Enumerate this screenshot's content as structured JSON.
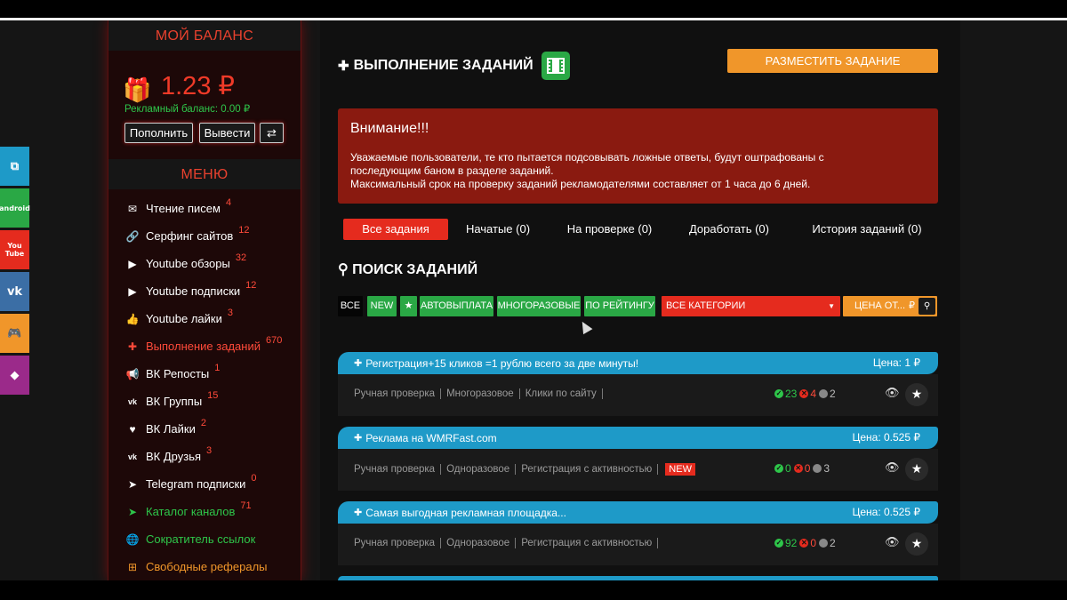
{
  "sidebar": {
    "balance_title": "МОЙ БАЛАНС",
    "balance_amount": "1.23 ₽",
    "ad_balance": "Рекламный баланс: 0.00 ₽",
    "btn_topup": "Пополнить",
    "btn_withdraw": "Вывести",
    "btn_exchange": "⇄",
    "menu_title": "МЕНЮ",
    "items": [
      {
        "label": "Чтение писем",
        "count": "4",
        "icon": "✉"
      },
      {
        "label": "Серфинг сайтов",
        "count": "12",
        "icon": "🔗"
      },
      {
        "label": "Youtube обзоры",
        "count": "32",
        "icon": "▶"
      },
      {
        "label": "Youtube подписки",
        "count": "12",
        "icon": "▶"
      },
      {
        "label": "Youtube лайки",
        "count": "3",
        "icon": "👍"
      },
      {
        "label": "Выполнение заданий",
        "count": "670",
        "icon": "✚"
      },
      {
        "label": "ВК Репосты",
        "count": "1",
        "icon": "📢"
      },
      {
        "label": "ВК Группы",
        "count": "15",
        "icon": "vk"
      },
      {
        "label": "ВК Лайки",
        "count": "2",
        "icon": "♥"
      },
      {
        "label": "ВК Друзья",
        "count": "3",
        "icon": "vk"
      },
      {
        "label": "Telegram подписки",
        "count": "0",
        "icon": "➤"
      },
      {
        "label": "Каталог каналов",
        "count": "71",
        "icon": "➤"
      },
      {
        "label": "Сократитель ссылок",
        "count": "",
        "icon": "🌐"
      },
      {
        "label": "Свободные рефералы",
        "count": "",
        "icon": "⊞"
      }
    ]
  },
  "social": [
    "⧉",
    "android",
    "You Tube",
    "vk",
    "🎮",
    "◆"
  ],
  "main": {
    "title": "ВЫПОЛНЕНИЕ ЗАДАНИЙ",
    "place_button": "РАЗМЕСТИТЬ ЗАДАНИЕ",
    "notice_title": "Внимание!!!",
    "notice_line1": "Уважаемые пользователи, те кто пытается подсовывать ложные ответы, будут оштрафованы с",
    "notice_line2": "последующим баном в разделе заданий.",
    "notice_line3": "Максимальный срок на проверку заданий рекламодателями составляет от 1 часа до 6 дней.",
    "tabs": [
      "Все задания",
      "Начатые (0)",
      "На проверке (0)",
      "Доработать (0)",
      "История заданий (0)"
    ],
    "search_title": "ПОИСК ЗАДАНИЙ",
    "filters": {
      "all": "ВСЕ",
      "new": "NEW",
      "star": "★",
      "auto": "АВТОВЫПЛАТА",
      "multi": "МНОГОРАЗОВЫЕ",
      "rating": "ПО РЕЙТИНГУ",
      "category": "ВСЕ КАТЕГОРИИ",
      "price": "ЦЕНА ОТ...",
      "price_symbol": "₽"
    },
    "tasks": [
      {
        "title": "Регистрация+15 кликов =1 рублю всего за две минуты!",
        "price": "Цена: 1 ₽",
        "tags": [
          "Ручная проверка",
          "Многоразовое",
          "Клики по сайту"
        ],
        "new": "",
        "ok": "23",
        "fail": "4",
        "wait": "2"
      },
      {
        "title": "Реклама на WMRFast.com",
        "price": "Цена: 0.525 ₽",
        "tags": [
          "Ручная проверка",
          "Одноразовое",
          "Регистрация с активностью"
        ],
        "new": "NEW",
        "ok": "0",
        "fail": "0",
        "wait": "3"
      },
      {
        "title": "Самая выгодная рекламная площадка...",
        "price": "Цена: 0.525 ₽",
        "tags": [
          "Ручная проверка",
          "Одноразовое",
          "Регистрация с активностью"
        ],
        "new": "",
        "ok": "92",
        "fail": "0",
        "wait": "2"
      }
    ]
  },
  "colors": {
    "accent_red": "#e52b1e",
    "green": "#2aa845",
    "orange": "#f0962a",
    "blue": "#1e9ac8"
  }
}
